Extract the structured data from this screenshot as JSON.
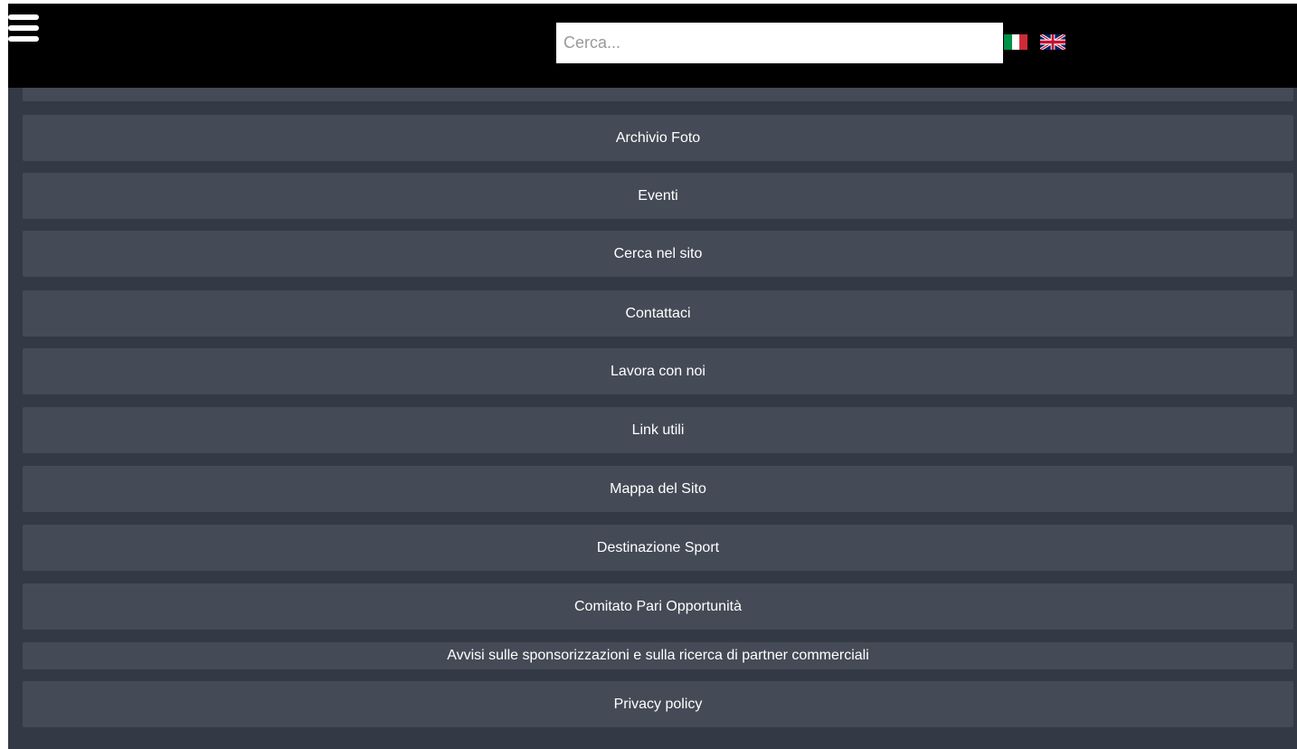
{
  "header": {
    "search_placeholder": "Cerca...",
    "menu_icon": "hamburger-icon",
    "flags": [
      "italian-flag-icon",
      "uk-flag-icon"
    ]
  },
  "menu": {
    "items": [
      {
        "label": ""
      },
      {
        "label": "Archivio Foto"
      },
      {
        "label": "Eventi"
      },
      {
        "label": "Cerca nel sito"
      },
      {
        "label": "Contattaci"
      },
      {
        "label": "Lavora con noi"
      },
      {
        "label": "Link utili"
      },
      {
        "label": "Mappa del Sito"
      },
      {
        "label": "Destinazione Sport"
      },
      {
        "label": "Comitato Pari Opportunità"
      },
      {
        "label": "Avvisi sulle sponsorizzazioni e sulla ricerca di partner commerciali"
      },
      {
        "label": "Privacy policy"
      }
    ]
  },
  "colors": {
    "header_bg": "#000000",
    "panel_bg": "#343a45",
    "item_bg": "#444b56",
    "text": "#ffffff"
  }
}
